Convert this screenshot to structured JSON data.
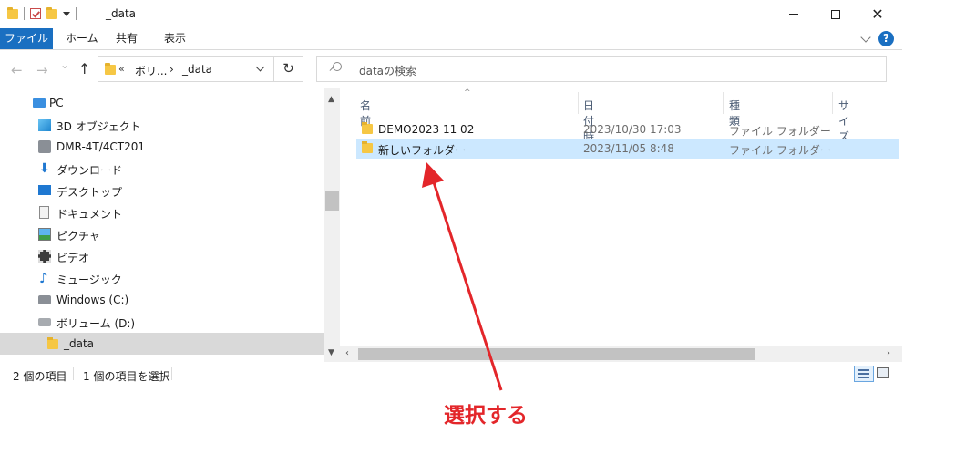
{
  "window": {
    "title": "_data",
    "minimize_icon": "minimize-icon",
    "maximize_icon": "maximize-icon",
    "close_glyph": "✕"
  },
  "ribbon": {
    "tabs": [
      "ファイル",
      "ホーム",
      "共有",
      "表示"
    ],
    "help_glyph": "?"
  },
  "nav": {
    "back_glyph": "←",
    "forward_glyph": "→",
    "recent_glyph": "⌄",
    "up_glyph": "↑",
    "breadcrumbs": [
      "ボリ...",
      "_data"
    ],
    "overflow_glyph": "«",
    "sep_glyph": "›",
    "refresh_glyph": "↻"
  },
  "search": {
    "placeholder": "_dataの検索"
  },
  "sidebar": {
    "items": [
      {
        "label": "PC",
        "icon": "pc-icon"
      },
      {
        "label": "3D オブジェクト",
        "icon": "3d-objects-icon"
      },
      {
        "label": "DMR-4T/4CT201",
        "icon": "network-drive-icon"
      },
      {
        "label": "ダウンロード",
        "icon": "download-icon"
      },
      {
        "label": "デスクトップ",
        "icon": "desktop-icon"
      },
      {
        "label": "ドキュメント",
        "icon": "document-icon"
      },
      {
        "label": "ピクチャ",
        "icon": "pictures-icon"
      },
      {
        "label": "ビデオ",
        "icon": "video-icon"
      },
      {
        "label": "ミュージック",
        "icon": "music-icon"
      },
      {
        "label": "Windows (C:)",
        "icon": "windows-drive-icon"
      },
      {
        "label": "ボリューム (D:)",
        "icon": "volume-drive-icon"
      },
      {
        "label": "_data",
        "icon": "folder-icon",
        "selected": true
      }
    ]
  },
  "filelist": {
    "columns": [
      "名前",
      "日付時刻",
      "種類",
      "サイズ"
    ],
    "rows": [
      {
        "name": "DEMO2023 11 02",
        "date": "2023/10/30 17:03",
        "type": "ファイル フォルダー",
        "selected": false
      },
      {
        "name": "新しいフォルダー",
        "date": "2023/11/05 8:48",
        "type": "ファイル フォルダー",
        "selected": true
      }
    ]
  },
  "statusbar": {
    "item_count": "2 個の項目",
    "selection_count": "1 個の項目を選択"
  },
  "annotation": {
    "label": "選択する",
    "color": "#e3262a"
  },
  "colors": {
    "accent": "#1a6fc1",
    "selection": "#cce8ff"
  }
}
